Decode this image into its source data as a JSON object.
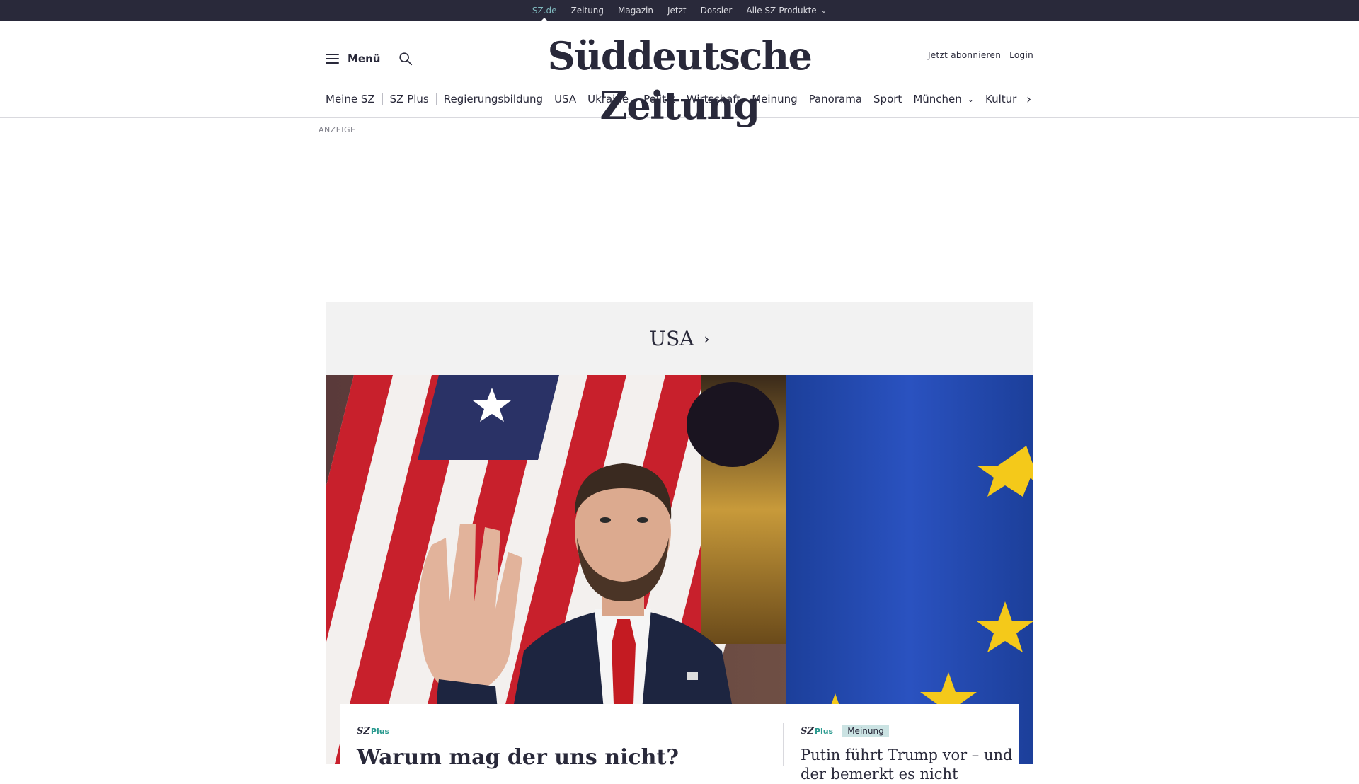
{
  "topbar": {
    "links": [
      "SZ.de",
      "Zeitung",
      "Magazin",
      "Jetzt",
      "Dossier",
      "Alle SZ-Produkte"
    ]
  },
  "header": {
    "menu_label": "Menü",
    "logo": "Süddeutsche Zeitung",
    "subscribe": "Jetzt abonnieren",
    "login": "Login"
  },
  "nav": {
    "items": [
      "Meine SZ",
      "SZ Plus",
      "Regierungsbildung",
      "USA",
      "Ukraine",
      "Politik",
      "Wirtschaft",
      "Meinung",
      "Panorama",
      "Sport",
      "München",
      "Kultur"
    ]
  },
  "ad": {
    "label": "ANZEIGE"
  },
  "section": {
    "title": "USA"
  },
  "hero": {
    "alt": ""
  },
  "teasers": {
    "main": {
      "brand_sz": "SZ",
      "brand_plus": "Plus",
      "headline": "Warum mag der uns nicht?"
    },
    "side": {
      "brand_sz": "SZ",
      "brand_plus": "Plus",
      "badge": "Meinung",
      "headline": "Putin führt Trump vor – und der bemerkt es nicht"
    }
  },
  "colors": {
    "topbar_bg": "#29293a",
    "accent": "#7fb8bd",
    "plus_green": "#2a9a8f",
    "badge_bg": "#cbe3e3"
  }
}
